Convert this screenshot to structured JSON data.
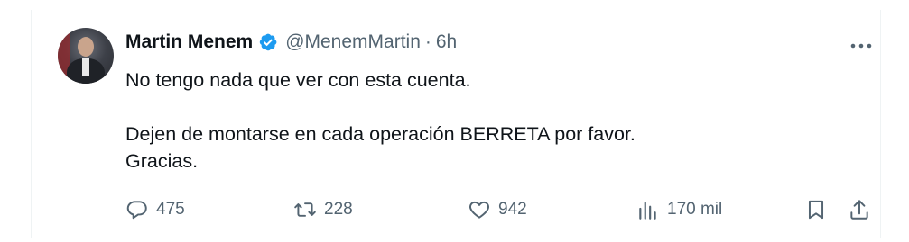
{
  "tweet": {
    "author_name": "Martin Menem",
    "handle": "@MenemMartin",
    "separator": "·",
    "time": "6h",
    "lines": [
      "No tengo nada que ver con esta cuenta.",
      "Dejen de montarse en cada operación BERRETA por favor.",
      "Gracias."
    ]
  },
  "actions": {
    "replies": "475",
    "reposts": "228",
    "likes": "942",
    "views": "170 mil"
  },
  "icons": {
    "verified": "verified-badge-icon",
    "more": "more-icon",
    "reply": "reply-icon",
    "repost": "repost-icon",
    "like": "heart-icon",
    "views": "views-icon",
    "bookmark": "bookmark-icon",
    "share": "share-icon"
  },
  "colors": {
    "text": "#0f1419",
    "secondary": "#536471",
    "verified": "#1d9bf0"
  }
}
